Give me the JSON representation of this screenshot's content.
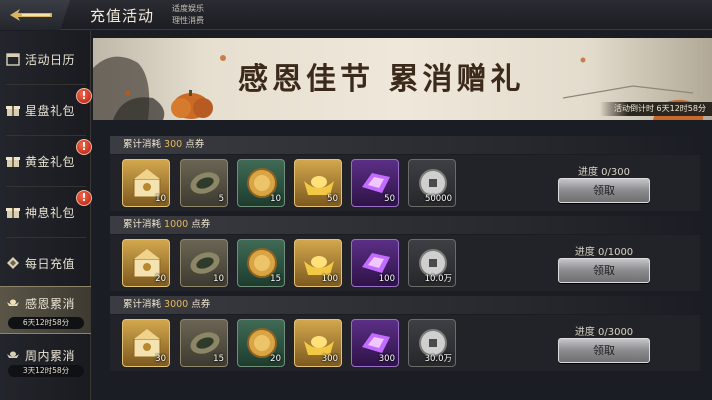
{
  "header": {
    "title": "充值活动",
    "notice_line1": "适度娱乐",
    "notice_line2": "理性消费"
  },
  "sidebar": {
    "items": [
      {
        "label": "活动日历",
        "icon": "calendar-icon",
        "badge": ""
      },
      {
        "label": "星盘礼包",
        "icon": "gift-icon",
        "badge": "!"
      },
      {
        "label": "黄金礼包",
        "icon": "gift-icon",
        "badge": "!"
      },
      {
        "label": "神息礼包",
        "icon": "gift-icon",
        "badge": "!"
      },
      {
        "label": "每日充值",
        "icon": "diamond-icon",
        "badge": ""
      },
      {
        "label": "感恩累消",
        "icon": "ingot-icon",
        "badge": "",
        "timer": "6天12时58分",
        "active": true
      },
      {
        "label": "周内累消",
        "icon": "ingot-icon",
        "badge": "",
        "timer": "3天12时58分"
      }
    ]
  },
  "banner": {
    "title": "感恩佳节 累消赠礼",
    "countdown": "活动倒计时 6天12时58分"
  },
  "tiers": [
    {
      "head_prefix": "累计消耗 ",
      "amount": "300",
      "head_suffix": " 点券",
      "progress": "进度 0/300",
      "button": "领取",
      "items": [
        {
          "name": "dragon-chest-icon",
          "qty": "10",
          "quality": "gold"
        },
        {
          "name": "jade-tablet-icon",
          "qty": "5",
          "quality": "grey"
        },
        {
          "name": "gold-coin-icon",
          "qty": "10",
          "quality": "green"
        },
        {
          "name": "gold-ingot-icon",
          "qty": "50",
          "quality": "gold"
        },
        {
          "name": "purple-crystal-icon",
          "qty": "50",
          "quality": "purple"
        },
        {
          "name": "silver-coin-icon",
          "qty": "50000",
          "quality": "dark"
        }
      ]
    },
    {
      "head_prefix": "累计消耗 ",
      "amount": "1000",
      "head_suffix": " 点券",
      "progress": "进度 0/1000",
      "button": "领取",
      "items": [
        {
          "name": "dragon-chest-icon",
          "qty": "20",
          "quality": "gold"
        },
        {
          "name": "jade-tablet-icon",
          "qty": "10",
          "quality": "grey"
        },
        {
          "name": "gold-coin-icon",
          "qty": "15",
          "quality": "green"
        },
        {
          "name": "gold-ingot-icon",
          "qty": "100",
          "quality": "gold"
        },
        {
          "name": "purple-crystal-icon",
          "qty": "100",
          "quality": "purple"
        },
        {
          "name": "silver-coin-icon",
          "qty": "10.0万",
          "quality": "dark"
        }
      ]
    },
    {
      "head_prefix": "累计消耗 ",
      "amount": "3000",
      "head_suffix": " 点券",
      "progress": "进度 0/3000",
      "button": "领取",
      "items": [
        {
          "name": "dragon-chest-icon",
          "qty": "30",
          "quality": "gold"
        },
        {
          "name": "jade-tablet-icon",
          "qty": "15",
          "quality": "grey"
        },
        {
          "name": "gold-coin-icon",
          "qty": "20",
          "quality": "green"
        },
        {
          "name": "gold-ingot-icon",
          "qty": "300",
          "quality": "gold"
        },
        {
          "name": "purple-crystal-icon",
          "qty": "300",
          "quality": "purple"
        },
        {
          "name": "silver-coin-icon",
          "qty": "30.0万",
          "quality": "dark"
        }
      ]
    }
  ],
  "colors": {
    "accent_gold": "#e8b95a",
    "badge_red": "#c8210f",
    "panel_bg": "#222328"
  }
}
